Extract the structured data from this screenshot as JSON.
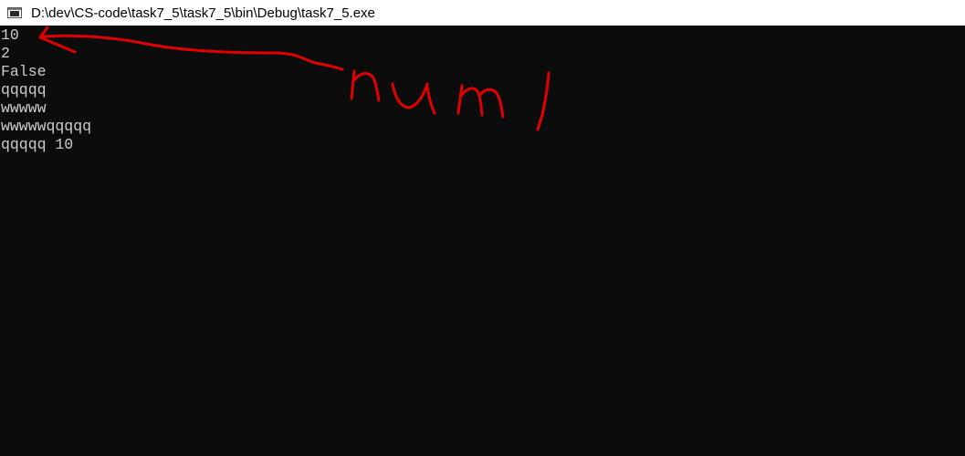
{
  "window": {
    "title": "D:\\dev\\CS-code\\task7_5\\task7_5\\bin\\Debug\\task7_5.exe",
    "icon": "console-app-icon"
  },
  "console": {
    "lines": [
      "10",
      "2",
      "False",
      "qqqqq",
      "wwwww",
      "wwwwwqqqqq",
      "qqqqq 10"
    ],
    "text_color": "#cccccc",
    "background_color": "#0c0c0c"
  },
  "annotation": {
    "handwritten_text": "num1",
    "color": "#e00000"
  }
}
